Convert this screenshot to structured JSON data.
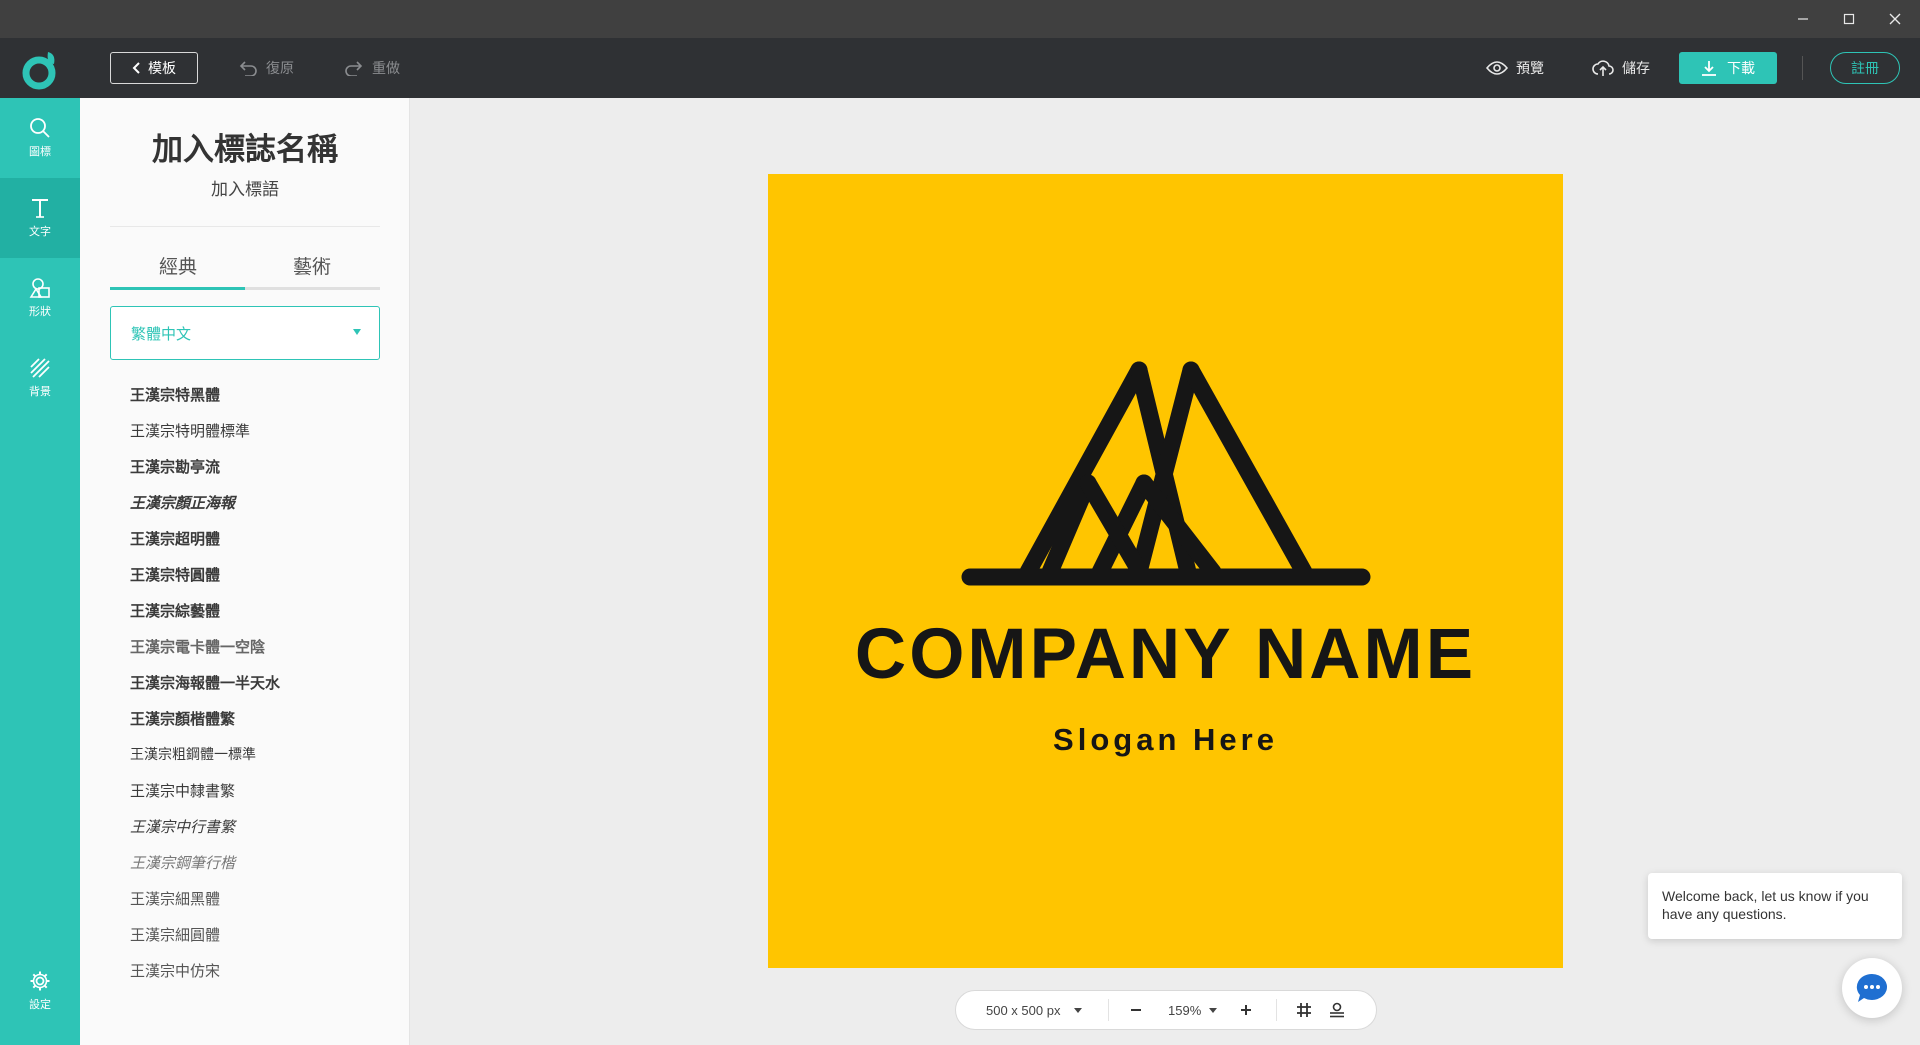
{
  "header": {
    "template_label": "模板",
    "undo_label": "復原",
    "redo_label": "重做",
    "preview_label": "預覽",
    "save_label": "儲存",
    "download_label": "下載",
    "signup_label": "註冊"
  },
  "rail": {
    "items": [
      {
        "label": "圖標",
        "icon": "search-icon"
      },
      {
        "label": "文字",
        "icon": "text-icon"
      },
      {
        "label": "形狀",
        "icon": "shapes-icon"
      },
      {
        "label": "背景",
        "icon": "background-icon"
      }
    ],
    "settings_label": "設定"
  },
  "panel": {
    "title": "加入標誌名稱",
    "subtitle": "加入標語",
    "tabs": [
      {
        "label": "經典"
      },
      {
        "label": "藝術"
      }
    ],
    "language": "繁體中文",
    "fonts": [
      "王漢宗特黑體",
      "王漢宗特明體標準",
      "王漢宗勘亭流",
      "王漢宗顏正海報",
      "王漢宗超明體",
      "王漢宗特圓體",
      "王漢宗綜藝體",
      "王漢宗電卡體一空陰",
      "王漢宗海報體一半天水",
      "王漢宗顏楷體繁",
      "王漢宗粗鋼體一標準",
      "王漢宗中隸書繁",
      "王漢宗中行書繁",
      "王漢宗鋼筆行楷",
      "王漢宗細黑體",
      "王漢宗細圓體",
      "王漢宗中仿宋"
    ]
  },
  "canvas": {
    "background": "#ffc500",
    "company_name": "COMPANY NAME",
    "slogan": "Slogan Here"
  },
  "toolbar": {
    "size_label": "500 x 500 px",
    "zoom_label": "159%"
  },
  "chat": {
    "message": "Welcome back, let us know if you have any questions."
  },
  "colors": {
    "accent": "#2ec4b6",
    "header": "#2f3134",
    "logo_bg": "#ffc500"
  }
}
